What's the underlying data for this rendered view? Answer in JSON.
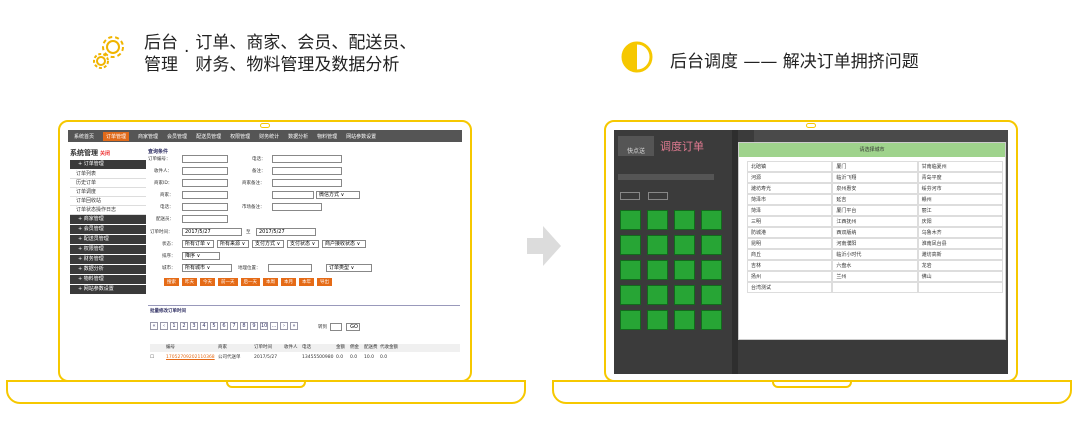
{
  "left_caption": {
    "title_line1": "后台",
    "title_line2": "管理",
    "sep": "·",
    "desc_line1": "订单、商家、会员、配送员、",
    "desc_line2": "财务、物料管理及数据分析",
    "icon": "gear-icon"
  },
  "right_caption": {
    "text": "后台调度 —— 解决订单拥挤问题",
    "icon": "half-circle-icon"
  },
  "colors": {
    "accent": "#f6c800",
    "nav_active": "#e06a1a",
    "tile_green": "#27a535"
  },
  "admin": {
    "nav": [
      "系统首页",
      "订单管理",
      "商家管理",
      "会员管理",
      "配送员管理",
      "权限管理",
      "财务统计",
      "数据分析",
      "物料管理",
      "网站参数设置"
    ],
    "nav_active_index": 1,
    "side_title": "系统管理",
    "side_close": "关闭",
    "side_groups": [
      {
        "label": "订单管理",
        "items": [
          "订单列表",
          "历史订单",
          "订单调度",
          "订单回收站",
          "订单状态操作日志"
        ]
      },
      {
        "label": "商家管理",
        "items": []
      },
      {
        "label": "会员管理",
        "items": []
      },
      {
        "label": "配送员管理",
        "items": []
      },
      {
        "label": "权限管理",
        "items": []
      },
      {
        "label": "财务管理",
        "items": []
      },
      {
        "label": "数据分析",
        "items": []
      },
      {
        "label": "物料管理",
        "items": []
      },
      {
        "label": "网站参数设置",
        "items": []
      }
    ],
    "form": {
      "title": "查询条件",
      "order_no": "订单编号：",
      "phone": "电话：",
      "receiver": "收件人：",
      "remark": "备注：",
      "shop_id": "商家ID：",
      "shop_remark": "商家备注：",
      "shop": "商家：",
      "pay_method": "微信方式",
      "tel": "电话：",
      "shop_note": "市场备注：",
      "rider": "配送员：",
      "order_time": "订单时间：",
      "date_from": "2017/5/27",
      "date_to_sep": "至",
      "date_to": "2017/5/27",
      "status": "状态：",
      "status_opts": [
        "所有订单",
        "所有来源",
        "支付方式",
        "支付状态",
        "商户接收状态"
      ],
      "sort": "排序：",
      "sort_opt": "降序",
      "city": "城市：",
      "city_opt": "所有城市",
      "area": "地理位置：",
      "order_type": "订单类型",
      "buttons": [
        "搜索",
        "昨天",
        "今天",
        "前一天",
        "后一天",
        "本周",
        "本月",
        "本年",
        "导出"
      ]
    },
    "batch_title": "批量修改订单时间",
    "pager": [
      "«",
      "‹",
      "1",
      "2",
      "3",
      "4",
      "5",
      "6",
      "7",
      "8",
      "9",
      "10",
      "...",
      "›",
      "»"
    ],
    "pager_goto": "转到",
    "pager_go": "GO",
    "table_headers": [
      "编号",
      "商家",
      "订单时间",
      "收件人",
      "电话",
      "金额",
      "佣金",
      "配送费",
      "代收金额"
    ],
    "row": [
      "17052709202110368",
      "公司代送单",
      "2017/5/27",
      "",
      "13455500980",
      "0.0",
      "0.0",
      "10.0",
      "0.0"
    ]
  },
  "dispatch": {
    "header": "调度订单",
    "logo": "快点送",
    "modal_title": "请选择城市",
    "cities": [
      "北碚镇",
      "厦门",
      "甘南临夏州",
      "河源",
      "临沂飞翔",
      "青岛平度",
      "潍坊寿光",
      "泉州惠安",
      "绥芬河市",
      "菏泽市",
      "延吉",
      "赣州",
      "菏泽",
      "厦门平台",
      "丽江",
      "三明",
      "江西抚州",
      "庆阳",
      "防城港",
      "西双版纳",
      "乌鲁木齐",
      "昆明",
      "河南濮阳",
      "淮南凤台县",
      "商丘",
      "临沂小时代",
      "潍坊高新",
      "吉林",
      "六盘水",
      "龙岩",
      "扬州",
      "兰州",
      "佛山",
      "台湾测试",
      "",
      ""
    ]
  }
}
